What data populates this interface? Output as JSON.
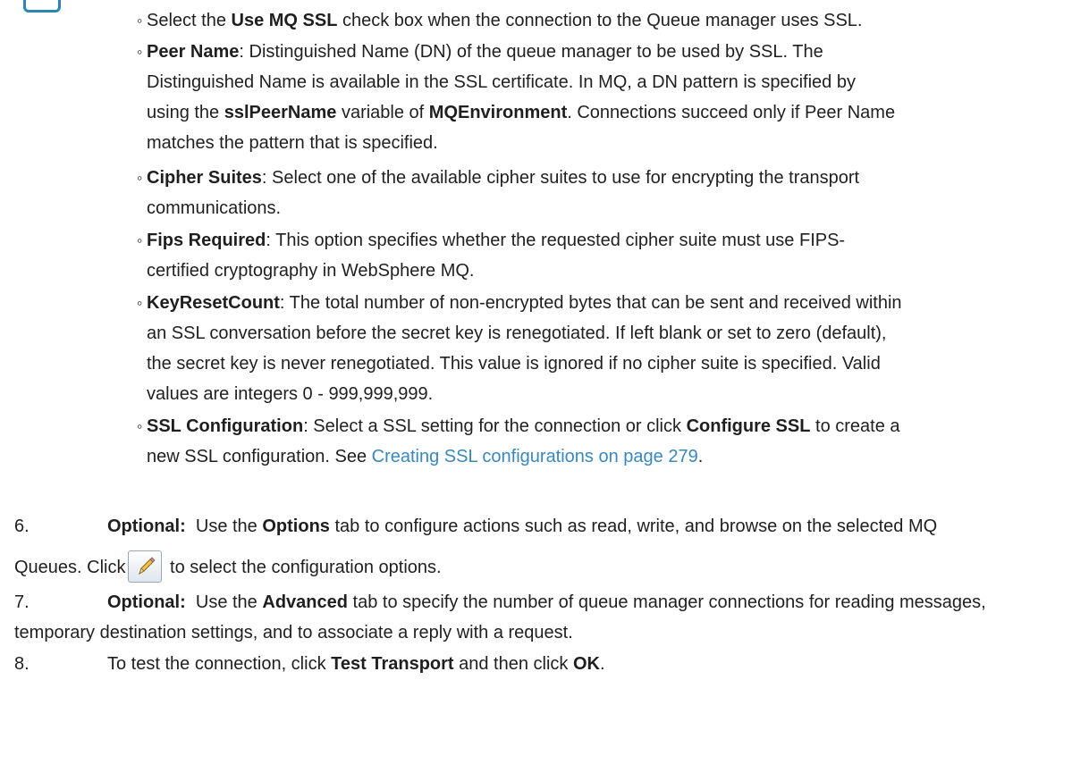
{
  "ssl_sub_items": [
    {
      "prefix": "Select the ",
      "bold": "Use MQ SSL",
      "suffix": " check box when the connection to the Queue manager uses SSL."
    },
    {
      "lines": [
        [
          {
            "t": "Peer Name",
            "b": true
          },
          {
            "t": ": Distinguished Name (DN) of the queue manager to be used by SSL. The"
          }
        ],
        [
          {
            "t": "Distinguished Name is available in the SSL certificate. In MQ, a DN pattern is specified by"
          }
        ],
        [
          {
            "t": "using the "
          },
          {
            "t": "sslPeerName",
            "b": true
          },
          {
            "t": " variable of "
          },
          {
            "t": "MQEnvironment",
            "b": true
          },
          {
            "t": ". Connections succeed only if Peer Name"
          }
        ],
        [
          {
            "t": "matches the pattern that is specified."
          }
        ]
      ]
    },
    {
      "lines": [
        [
          {
            "t": "Cipher Suites",
            "b": true
          },
          {
            "t": ": Select one of the available cipher suites to use for encrypting the transport"
          }
        ],
        [
          {
            "t": "communications."
          }
        ]
      ]
    },
    {
      "lines": [
        [
          {
            "t": "Fips Required",
            "b": true
          },
          {
            "t": ": This option specifies whether the requested cipher suite must use FIPS-"
          }
        ],
        [
          {
            "t": "certified cryptography in WebSphere MQ."
          }
        ]
      ]
    },
    {
      "lines": [
        [
          {
            "t": "KeyResetCount",
            "b": true
          },
          {
            "t": ": The total number of non-encrypted bytes that can be sent and received within"
          }
        ],
        [
          {
            "t": "an SSL conversation before the secret key is renegotiated. If left blank or set to zero (default),"
          }
        ],
        [
          {
            "t": "the secret key is never renegotiated. This value is ignored if no cipher suite is specified. Valid"
          }
        ],
        [
          {
            "t": "values are integers 0 - 999,999,999."
          }
        ]
      ]
    },
    {
      "lines": [
        [
          {
            "t": "SSL Configuration",
            "b": true
          },
          {
            "t": ": Select a SSL setting for the connection or click "
          },
          {
            "t": "Configure SSL",
            "b": true
          },
          {
            "t": " to create a"
          }
        ],
        [
          {
            "t": "new SSL configuration. See "
          },
          {
            "t": "Creating SSL configurations on page 279",
            "link": true
          },
          {
            "t": "."
          }
        ]
      ]
    }
  ],
  "steps": [
    {
      "num": "6.",
      "line1": [
        {
          "t": "Optional:",
          "b": true
        },
        {
          "t": "  Use the "
        },
        {
          "t": "Options",
          "b": true
        },
        {
          "t": " tab to configure actions such as read, write, and browse on the selected MQ"
        }
      ],
      "line2_before": "Queues. Click",
      "line2_after": " to select the configuration options.",
      "icon": "edit-pencil-icon"
    },
    {
      "num": "7.",
      "line1": [
        {
          "t": "Optional:",
          "b": true
        },
        {
          "t": "  Use the "
        },
        {
          "t": "Advanced",
          "b": true
        },
        {
          "t": " tab to specify the number of queue manager connections for reading messages,"
        }
      ],
      "line2": "temporary destination settings, and to associate a reply with a request."
    },
    {
      "num": "8.",
      "line1": [
        {
          "t": "To test the connection, click "
        },
        {
          "t": "Test Transport",
          "b": true
        },
        {
          "t": " and then click "
        },
        {
          "t": "OK",
          "b": true
        },
        {
          "t": "."
        }
      ]
    }
  ],
  "colors": {
    "link": "#3a87bd",
    "accent": "#2c86b5"
  }
}
